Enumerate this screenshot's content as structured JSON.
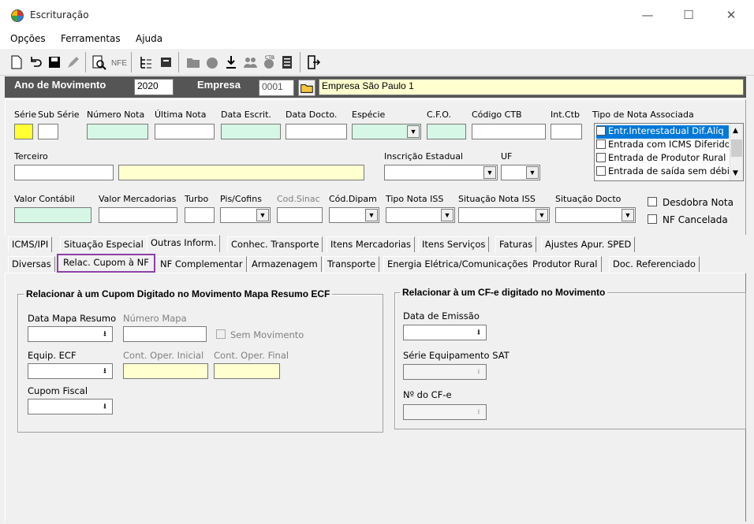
{
  "window": {
    "title": "Escrituração",
    "minimize": "—",
    "maximize": "☐",
    "close": "✕"
  },
  "menu": [
    "Opções",
    "Ferramentas",
    "Ajuda"
  ],
  "header": {
    "ano_label": "Ano de Movimento",
    "ano_value": "2020",
    "empresa_label": "Empresa",
    "empresa_code": "0001",
    "empresa_name": "Empresa São Paulo  1"
  },
  "form": {
    "labels": {
      "serie": "Série",
      "sub_serie": "Sub Série",
      "numero_nota": "Número Nota",
      "ultima_nota": "Última Nota",
      "data_escrit": "Data Escrit.",
      "data_docto": "Data Docto.",
      "especie": "Espécie",
      "cfo": "C.F.O.",
      "codigo_ctb": "Código CTB",
      "int_ctb": "Int.Ctb",
      "tipo_nota_assoc": "Tipo de Nota Associada",
      "terceiro": "Terceiro",
      "inscricao_estadual": "Inscrição Estadual",
      "uf": "UF",
      "valor_contabil": "Valor Contábil",
      "valor_mercadorias": "Valor Mercadorias",
      "turbo": "Turbo",
      "pis_cofins": "Pis/Cofins",
      "cod_sinac": "Cod.Sinac",
      "cod_dipam": "Cód.Dipam",
      "tipo_nota_iss": "Tipo Nota ISS",
      "situacao_nota_iss": "Situação Nota ISS",
      "situacao_docto": "Situação Docto"
    },
    "checks": {
      "desdobra_nota": "Desdobra Nota",
      "nf_cancelada": "NF Cancelada"
    },
    "tipo_nota_list": [
      "Entr.Interestadual Dif.Alíq",
      "Entrada com ICMS Diferido",
      "Entrada de Produtor Rural",
      "Entrada de saída sem débi"
    ]
  },
  "tabs_row1": [
    "ICMS/IPI",
    "Situação Especial",
    "Outras Inform.",
    "Conhec. Transporte",
    "Itens Mercadorias",
    "Itens Serviços",
    "Faturas",
    "Ajustes Apur. SPED"
  ],
  "tabs_row2": [
    "Diversas",
    "Relac. Cupom à NF",
    "NF Complementar",
    "Armazenagem",
    "Transporte",
    "Energia Elétrica/Comunicações",
    "Produtor Rural",
    "Doc. Referenciado"
  ],
  "group_ecf": {
    "title": "Relacionar à um Cupom Digitado no Movimento Mapa Resumo ECF",
    "data_mapa_resumo": "Data Mapa Resumo",
    "numero_mapa": "Número Mapa",
    "sem_movimento": "Sem Movimento",
    "equip_ecf": "Equip. ECF",
    "cont_oper_inicial": "Cont. Oper. Inicial",
    "cont_oper_final": "Cont. Oper. Final",
    "cupom_fiscal": "Cupom Fiscal"
  },
  "group_cfe": {
    "title": "Relacionar à um CF-e digitado no Movimento",
    "data_emissao": "Data de Emissão",
    "serie_sat": "Série Equipamento SAT",
    "numero_cfe": "Nº do CF-e"
  },
  "colors": {
    "header_bg": "#555555",
    "highlight_border": "#8e3fa8",
    "selection": "#0078d7"
  }
}
